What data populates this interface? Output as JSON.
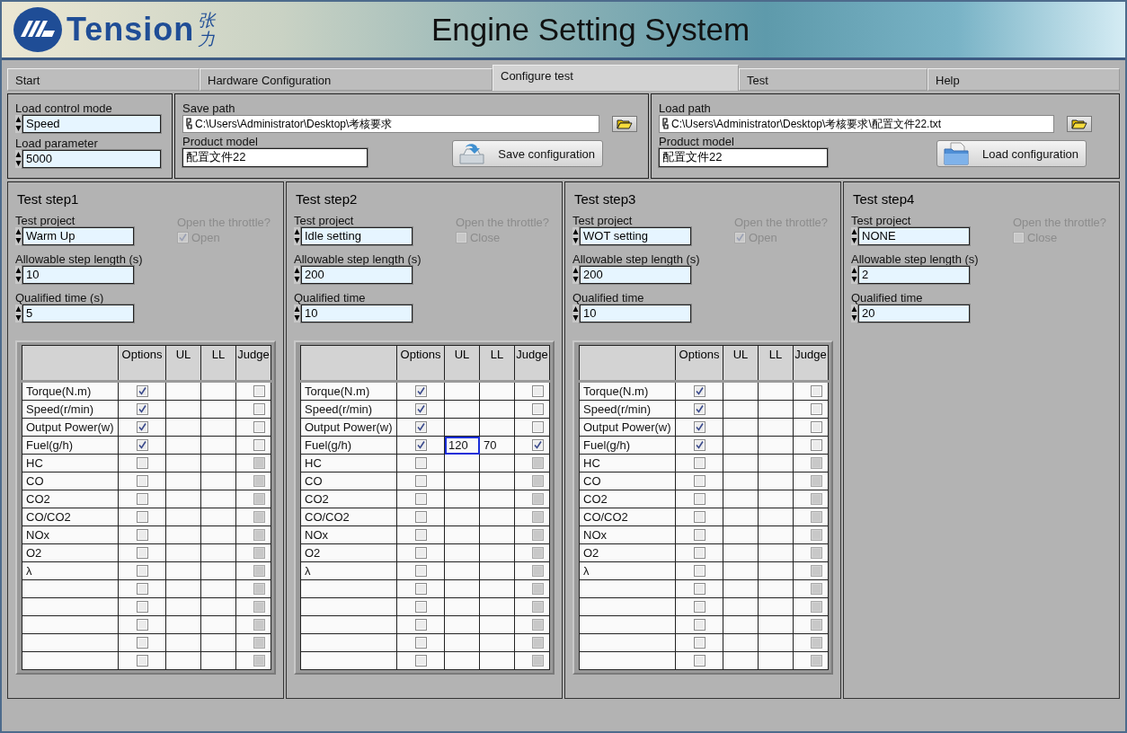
{
  "header": {
    "logo": {
      "name": "Tension",
      "chinese": "张力"
    },
    "title": "Engine Setting System"
  },
  "tabs": [
    {
      "label": "Start",
      "selected": false
    },
    {
      "label": "Hardware Configuration",
      "selected": false
    },
    {
      "label": "Configure test",
      "selected": true
    },
    {
      "label": "Test",
      "selected": false
    },
    {
      "label": "Help",
      "selected": false
    }
  ],
  "load_control": {
    "mode_label": "Load control mode",
    "mode": "Speed",
    "parameter_label": "Load parameter",
    "parameter": "5000"
  },
  "save": {
    "path_label": "Save path",
    "path": "C:\\Users\\Administrator\\Desktop\\考核要求",
    "model_label": "Product model",
    "model": "配置文件22",
    "button": "Save configuration"
  },
  "load": {
    "path_label": "Load path",
    "path": "C:\\Users\\Administrator\\Desktop\\考核要求\\配置文件22.txt",
    "model_label": "Product model",
    "model": "配置文件22",
    "button": "Load configuration"
  },
  "steps": [
    {
      "title": "Test step1",
      "project_label": "Test project",
      "project": "Warm Up",
      "throttle": {
        "label": "Open the throttle?",
        "option": "Open",
        "checked": true,
        "disabled": true
      },
      "step_length_label": "Allowable step length (s)",
      "step_length": "10",
      "qualified_label": "Qualified time (s)",
      "qualified": "5",
      "table": {
        "columns": [
          "Options",
          "UL",
          "LL",
          "Judge"
        ],
        "rows": [
          {
            "label": "Torque(N.m)",
            "options": true,
            "judge": false,
            "judge_disabled": false,
            "ul_focused": false
          },
          {
            "label": "Speed(r/min)",
            "options": true,
            "judge": false,
            "judge_disabled": false,
            "ul_focused": false
          },
          {
            "label": "Output Power(w)",
            "options": true,
            "judge": false,
            "judge_disabled": false,
            "ul_focused": false
          },
          {
            "label": "Fuel(g/h)",
            "options": true,
            "judge": false,
            "judge_disabled": false,
            "ul_focused": false
          },
          {
            "label": "HC",
            "options": false,
            "judge": false,
            "judge_disabled": true,
            "ul_focused": false
          },
          {
            "label": "CO",
            "options": false,
            "judge": false,
            "judge_disabled": true,
            "ul_focused": false
          },
          {
            "label": "CO2",
            "options": false,
            "judge": false,
            "judge_disabled": true,
            "ul_focused": false
          },
          {
            "label": "CO/CO2",
            "options": false,
            "judge": false,
            "judge_disabled": true,
            "ul_focused": false
          },
          {
            "label": "NOx",
            "options": false,
            "judge": false,
            "judge_disabled": true,
            "ul_focused": false
          },
          {
            "label": "O2",
            "options": false,
            "judge": false,
            "judge_disabled": true,
            "ul_focused": false
          },
          {
            "label": "λ",
            "options": false,
            "judge": false,
            "judge_disabled": true,
            "ul_focused": false
          },
          {
            "options": false,
            "judge": false,
            "judge_disabled": true,
            "ul_focused": false
          },
          {
            "options": false,
            "judge": false,
            "judge_disabled": true,
            "ul_focused": false
          },
          {
            "options": false,
            "judge": false,
            "judge_disabled": true,
            "ul_focused": false
          },
          {
            "options": false,
            "judge": false,
            "judge_disabled": true,
            "ul_focused": false
          },
          {
            "options": false,
            "judge": false,
            "judge_disabled": true,
            "ul_focused": false
          }
        ]
      }
    },
    {
      "title": "Test step2",
      "project_label": "Test project",
      "project": "Idle setting",
      "throttle": {
        "label": "Open the throttle?",
        "option": "Close",
        "checked": false,
        "disabled": true
      },
      "step_length_label": "Allowable step length (s)",
      "step_length": "200",
      "qualified_label": "Qualified time",
      "qualified": "10",
      "table": {
        "columns": [
          "Options",
          "UL",
          "LL",
          "Judge"
        ],
        "rows": [
          {
            "label": "Torque(N.m)",
            "options": true,
            "judge": false,
            "judge_disabled": false,
            "ul_focused": false
          },
          {
            "label": "Speed(r/min)",
            "options": true,
            "judge": false,
            "judge_disabled": false,
            "ul_focused": false
          },
          {
            "label": "Output Power(w)",
            "options": true,
            "judge": false,
            "judge_disabled": false,
            "ul_focused": false
          },
          {
            "label": "Fuel(g/h)",
            "options": true,
            "ul": "120",
            "ll": "70",
            "judge": true,
            "judge_disabled": false,
            "ul_focused": true
          },
          {
            "label": "HC",
            "options": false,
            "judge": false,
            "judge_disabled": true,
            "ul_focused": false
          },
          {
            "label": "CO",
            "options": false,
            "judge": false,
            "judge_disabled": true,
            "ul_focused": false
          },
          {
            "label": "CO2",
            "options": false,
            "judge": false,
            "judge_disabled": true,
            "ul_focused": false
          },
          {
            "label": "CO/CO2",
            "options": false,
            "judge": false,
            "judge_disabled": true,
            "ul_focused": false
          },
          {
            "label": "NOx",
            "options": false,
            "judge": false,
            "judge_disabled": true,
            "ul_focused": false
          },
          {
            "label": "O2",
            "options": false,
            "judge": false,
            "judge_disabled": true,
            "ul_focused": false
          },
          {
            "label": "λ",
            "options": false,
            "judge": false,
            "judge_disabled": true,
            "ul_focused": false
          },
          {
            "options": false,
            "judge": false,
            "judge_disabled": true,
            "ul_focused": false
          },
          {
            "options": false,
            "judge": false,
            "judge_disabled": true,
            "ul_focused": false
          },
          {
            "options": false,
            "judge": false,
            "judge_disabled": true,
            "ul_focused": false
          },
          {
            "options": false,
            "judge": false,
            "judge_disabled": true,
            "ul_focused": false
          },
          {
            "options": false,
            "judge": false,
            "judge_disabled": true,
            "ul_focused": false
          }
        ]
      }
    },
    {
      "title": "Test step3",
      "project_label": "Test project",
      "project": "WOT setting",
      "throttle": {
        "label": "Open the throttle?",
        "option": "Open",
        "checked": true,
        "disabled": true
      },
      "step_length_label": "Allowable step length (s)",
      "step_length": "200",
      "qualified_label": "Qualified time",
      "qualified": "10",
      "table": {
        "columns": [
          "Options",
          "UL",
          "LL",
          "Judge"
        ],
        "rows": [
          {
            "label": "Torque(N.m)",
            "options": true,
            "judge": false,
            "judge_disabled": false,
            "ul_focused": false
          },
          {
            "label": "Speed(r/min)",
            "options": true,
            "judge": false,
            "judge_disabled": false,
            "ul_focused": false
          },
          {
            "label": "Output Power(w)",
            "options": true,
            "judge": false,
            "judge_disabled": false,
            "ul_focused": false
          },
          {
            "label": "Fuel(g/h)",
            "options": true,
            "judge": false,
            "judge_disabled": false,
            "ul_focused": false
          },
          {
            "label": "HC",
            "options": false,
            "judge": false,
            "judge_disabled": true,
            "ul_focused": false
          },
          {
            "label": "CO",
            "options": false,
            "judge": false,
            "judge_disabled": true,
            "ul_focused": false
          },
          {
            "label": "CO2",
            "options": false,
            "judge": false,
            "judge_disabled": true,
            "ul_focused": false
          },
          {
            "label": "CO/CO2",
            "options": false,
            "judge": false,
            "judge_disabled": true,
            "ul_focused": false
          },
          {
            "label": "NOx",
            "options": false,
            "judge": false,
            "judge_disabled": true,
            "ul_focused": false
          },
          {
            "label": "O2",
            "options": false,
            "judge": false,
            "judge_disabled": true,
            "ul_focused": false
          },
          {
            "label": "λ",
            "options": false,
            "judge": false,
            "judge_disabled": true,
            "ul_focused": false
          },
          {
            "options": false,
            "judge": false,
            "judge_disabled": true,
            "ul_focused": false
          },
          {
            "options": false,
            "judge": false,
            "judge_disabled": true,
            "ul_focused": false
          },
          {
            "options": false,
            "judge": false,
            "judge_disabled": true,
            "ul_focused": false
          },
          {
            "options": false,
            "judge": false,
            "judge_disabled": true,
            "ul_focused": false
          },
          {
            "options": false,
            "judge": false,
            "judge_disabled": true,
            "ul_focused": false
          }
        ]
      }
    },
    {
      "title": "Test step4",
      "project_label": "Test project",
      "project": "NONE",
      "throttle": {
        "label": "Open the throttle?",
        "option": "Close",
        "checked": false,
        "disabled": true
      },
      "step_length_label": "Allowable step length (s)",
      "step_length": "2",
      "qualified_label": "Qualified time",
      "qualified": "20"
    }
  ]
}
